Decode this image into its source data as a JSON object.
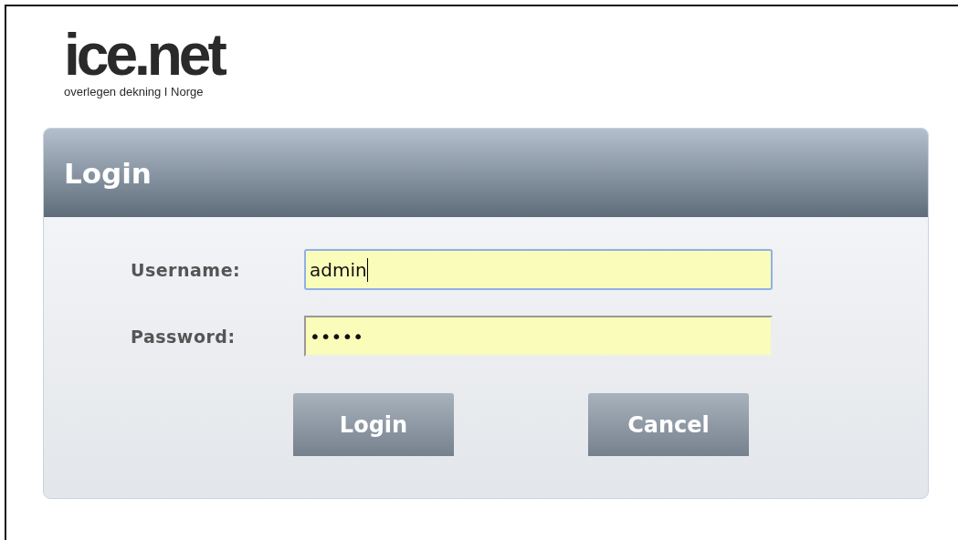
{
  "logo": {
    "name": "ice.net",
    "tagline": "overlegen dekning I Norge"
  },
  "dialog": {
    "title": "Login",
    "fields": [
      {
        "label": "Username:",
        "value": "admin",
        "focused": true
      },
      {
        "label": "Password:",
        "value": "•••••",
        "focused": false
      }
    ],
    "buttons": [
      "Login",
      "Cancel"
    ]
  }
}
